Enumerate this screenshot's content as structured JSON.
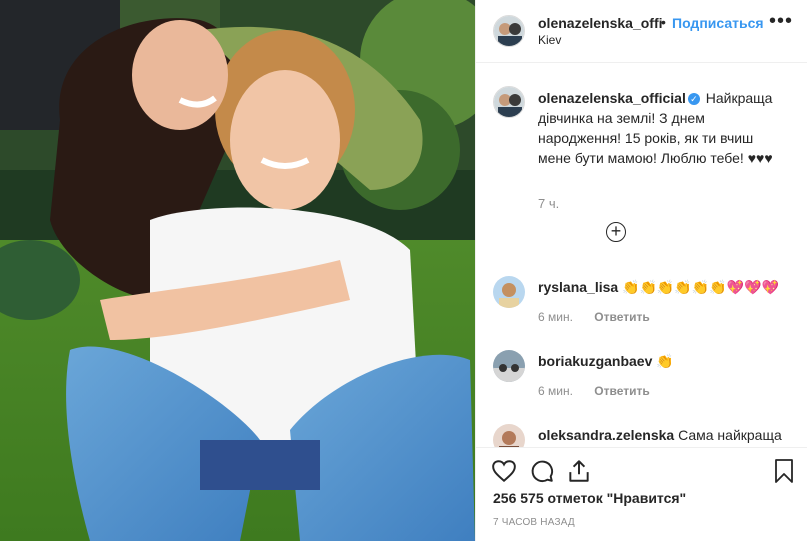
{
  "post": {
    "username": "olenazelenska_offi",
    "dot": "•",
    "follow_label": "Подписаться",
    "location": "Kiev",
    "more_icon": "more-icon"
  },
  "caption": {
    "username": "olenazelenska_official",
    "verified_icon": "verified-badge-icon",
    "text": "Найкраща дівчинка на землі! З днем народження! 15 років, як ти вчиш мене бути мамою! Люблю тебе! ♥♥♥",
    "time": "7 ч."
  },
  "load_more_icon": "plus-circle-icon",
  "comments": [
    {
      "username": "ryslana_lisa",
      "text": "👏👏👏👏👏👏💖💖💖",
      "time": "6 мин.",
      "reply": "Ответить"
    },
    {
      "username": "boriakuzganbaev",
      "text": "👏",
      "time": "6 мин.",
      "reply": "Ответить"
    },
    {
      "username": "oleksandra.zelenska",
      "text": "Сама найкраща",
      "time": "",
      "reply": ""
    }
  ],
  "actions": {
    "like_icon": "heart-icon",
    "comment_icon": "comment-icon",
    "share_icon": "share-icon",
    "save_icon": "bookmark-icon"
  },
  "likes": "256 575 отметок \"Нравится\"",
  "posted_ago": "7 ЧАСОВ НАЗАД",
  "colors": {
    "link": "#3897f0",
    "muted": "#8e8e8e",
    "text": "#262626",
    "border": "#efefef"
  }
}
